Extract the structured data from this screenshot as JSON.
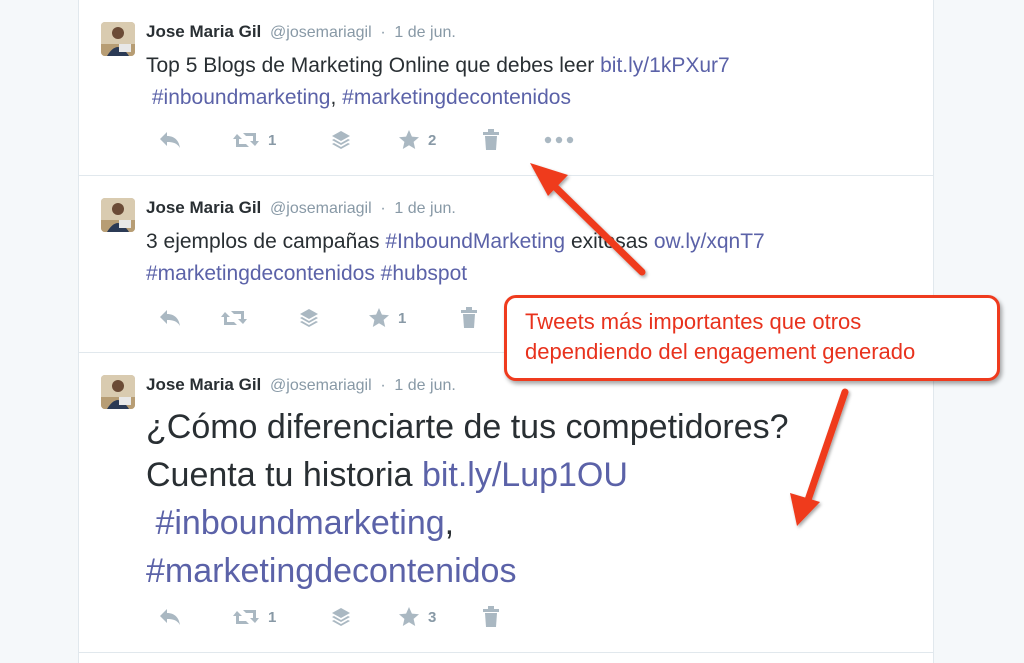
{
  "tweets": [
    {
      "fullname": "Jose Maria Gil",
      "username": "@josemariagil",
      "dot": "·",
      "time": "1 de jun.",
      "text_plain": "Top 5 Blogs de Marketing Online que debes leer ",
      "url": "bit.ly/1kPXur7",
      "tag1": "#inboundmarketing",
      "sep": ", ",
      "tag2": "#marketingdecontenidos",
      "retweets": "1",
      "favorites": "2"
    },
    {
      "fullname": "Jose Maria Gil",
      "username": "@josemariagil",
      "dot": "·",
      "time": "1 de jun.",
      "text_plain": "3 ejemplos de campañas ",
      "tag1": "#InboundMarketing",
      "text_mid": " exitosas ",
      "url": "ow.ly/xqnT7",
      "tag2": "#marketingdecontenidos",
      "tag3": "#hubspot",
      "favorites": "1"
    },
    {
      "fullname": "Jose Maria Gil",
      "username": "@josemariagil",
      "dot": "·",
      "time": "1 de jun.",
      "text_line1": "¿Cómo diferenciarte de tus competidores?",
      "text_line2": "Cuenta tu historia ",
      "url": "bit.ly/Lup1OU",
      "tag1": "#inboundmarketing",
      "sep": ",",
      "tag2": "#marketingdecontenidos",
      "retweets": "1",
      "favorites": "3"
    }
  ],
  "callout": {
    "line1": "Tweets más importantes que otros",
    "line2": "dependiendo del engagement generado"
  },
  "colors": {
    "accent": "#5b62a8",
    "callout_red": "#ef3b1e"
  }
}
